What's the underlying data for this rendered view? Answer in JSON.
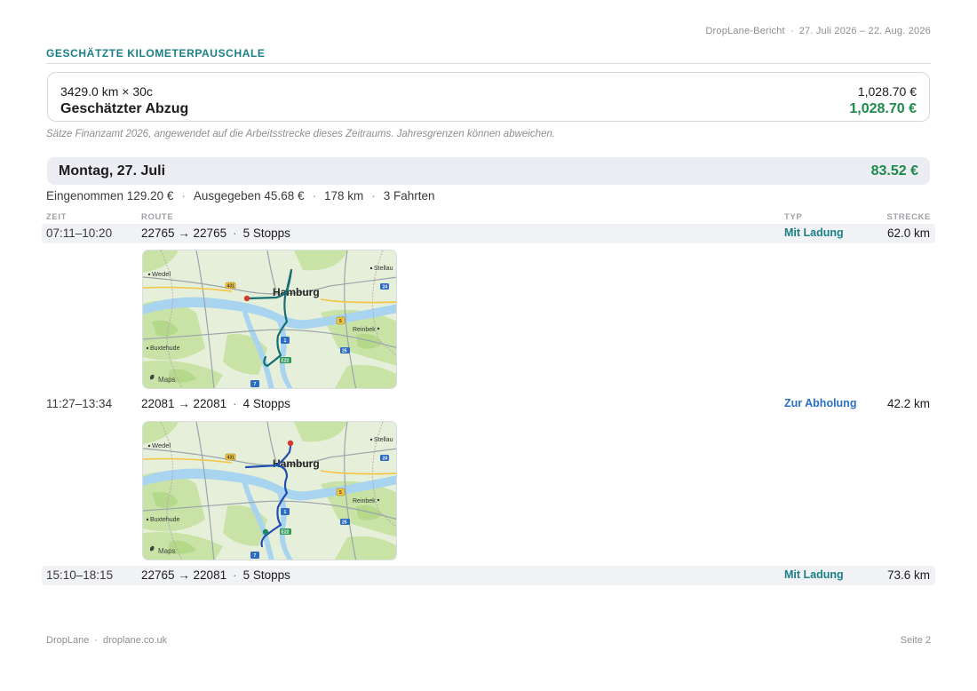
{
  "header": {
    "report_name": "DropLane-Bericht",
    "separator": "·",
    "date_range": "27. Juli 2026 – 22. Aug. 2026"
  },
  "mileage": {
    "section_title": "GESCHÄTZTE KILOMETERPAUSCHALE",
    "calc_label": "3429.0 km × 30c",
    "calc_amount": "1,028.70 €",
    "deduction_label": "Geschätzter Abzug",
    "deduction_amount": "1,028.70 €",
    "note": "Sätze Finanzamt 2026, angewendet auf die Arbeitsstrecke dieses Zeitraums. Jahresgrenzen können abweichen.",
    "accent_color": "#1b7f86",
    "amount_color": "#1e8a4c"
  },
  "day": {
    "title": "Montag, 27. Juli",
    "amount": "83.52 €",
    "stats": {
      "income": "Eingenommen 129.20 €",
      "expenses": "Ausgegeben 45.68 €",
      "distance": "178 km",
      "trips": "3 Fahrten",
      "separator": "·"
    }
  },
  "columns": {
    "time": "ZEIT",
    "route": "ROUTE",
    "type": "TYP",
    "distance": "STRECKE"
  },
  "trips": [
    {
      "time": "07:11–10:20",
      "route": "22765 → 22765",
      "stops": "5 Stopps",
      "type": "Mit Ladung",
      "type_color": "#1b7f86",
      "distance": "62.0 km"
    },
    {
      "time": "11:27–13:34",
      "route": "22081 → 22081",
      "stops": "4 Stopps",
      "type": "Zur Abholung",
      "type_color": "#2a6fc2",
      "distance": "42.2 km"
    },
    {
      "time": "15:10–18:15",
      "route": "22765 → 22081",
      "stops": "5 Stopps",
      "type": "Mit Ladung",
      "type_color": "#1b7f86",
      "distance": "73.6 km"
    }
  ],
  "map_labels": {
    "wedel": "Wedel",
    "stellau": "Stellau",
    "hamburg": "Hamburg",
    "reinbek": "Reinbek",
    "buxtehude": "Buxtehude",
    "attribution": "Maps",
    "road_431": "431",
    "road_24": "24",
    "road_5": "5",
    "road_1": "1",
    "road_25": "25",
    "road_7": "7",
    "road_e22": "E22"
  },
  "footer": {
    "brand": "DropLane",
    "separator": "·",
    "website": "droplane.co.uk",
    "page": "Seite 2"
  }
}
